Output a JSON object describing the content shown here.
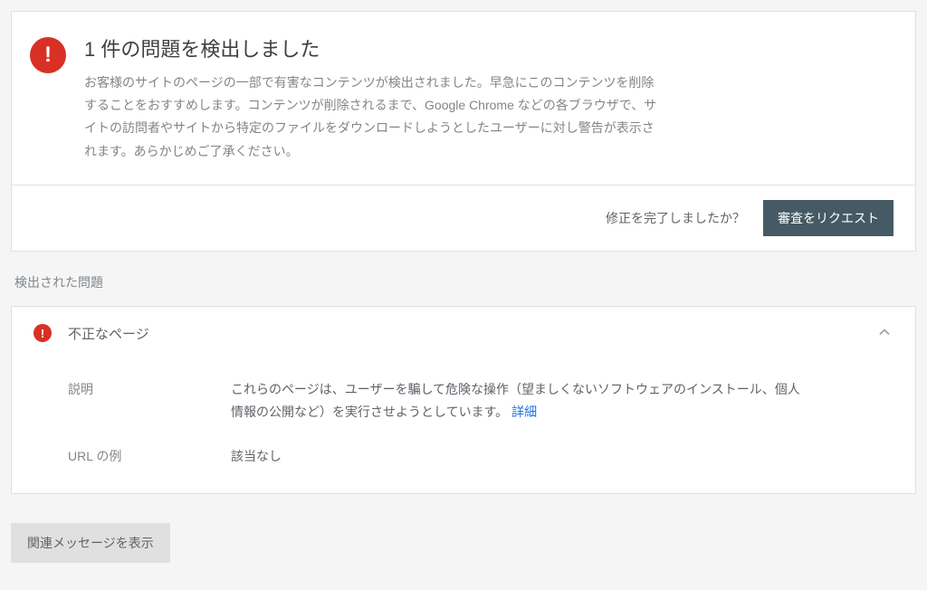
{
  "alert": {
    "title": "1 件の問題を検出しました",
    "description": "お客様のサイトのページの一部で有害なコンテンツが検出されました。早急にこのコンテンツを削除することをおすすめします。コンテンツが削除されるまで、Google Chrome などの各ブラウザで、サイトの訪問者やサイトから特定のファイルをダウンロードしようとしたユーザーに対し警告が表示されます。あらかじめご了承ください。"
  },
  "footer": {
    "prompt": "修正を完了しましたか？",
    "button": "審査をリクエスト"
  },
  "issues": {
    "heading": "検出された問題",
    "item": {
      "title": "不正なページ",
      "desc_label": "説明",
      "desc_value": "これらのページは、ユーザーを騙して危険な操作（望ましくないソフトウェアのインストール、個人情報の公開など）を実行させようとしています。",
      "desc_link": "詳細",
      "url_label": "URL の例",
      "url_value": "該当なし"
    }
  },
  "related_button": "関連メッセージを表示"
}
